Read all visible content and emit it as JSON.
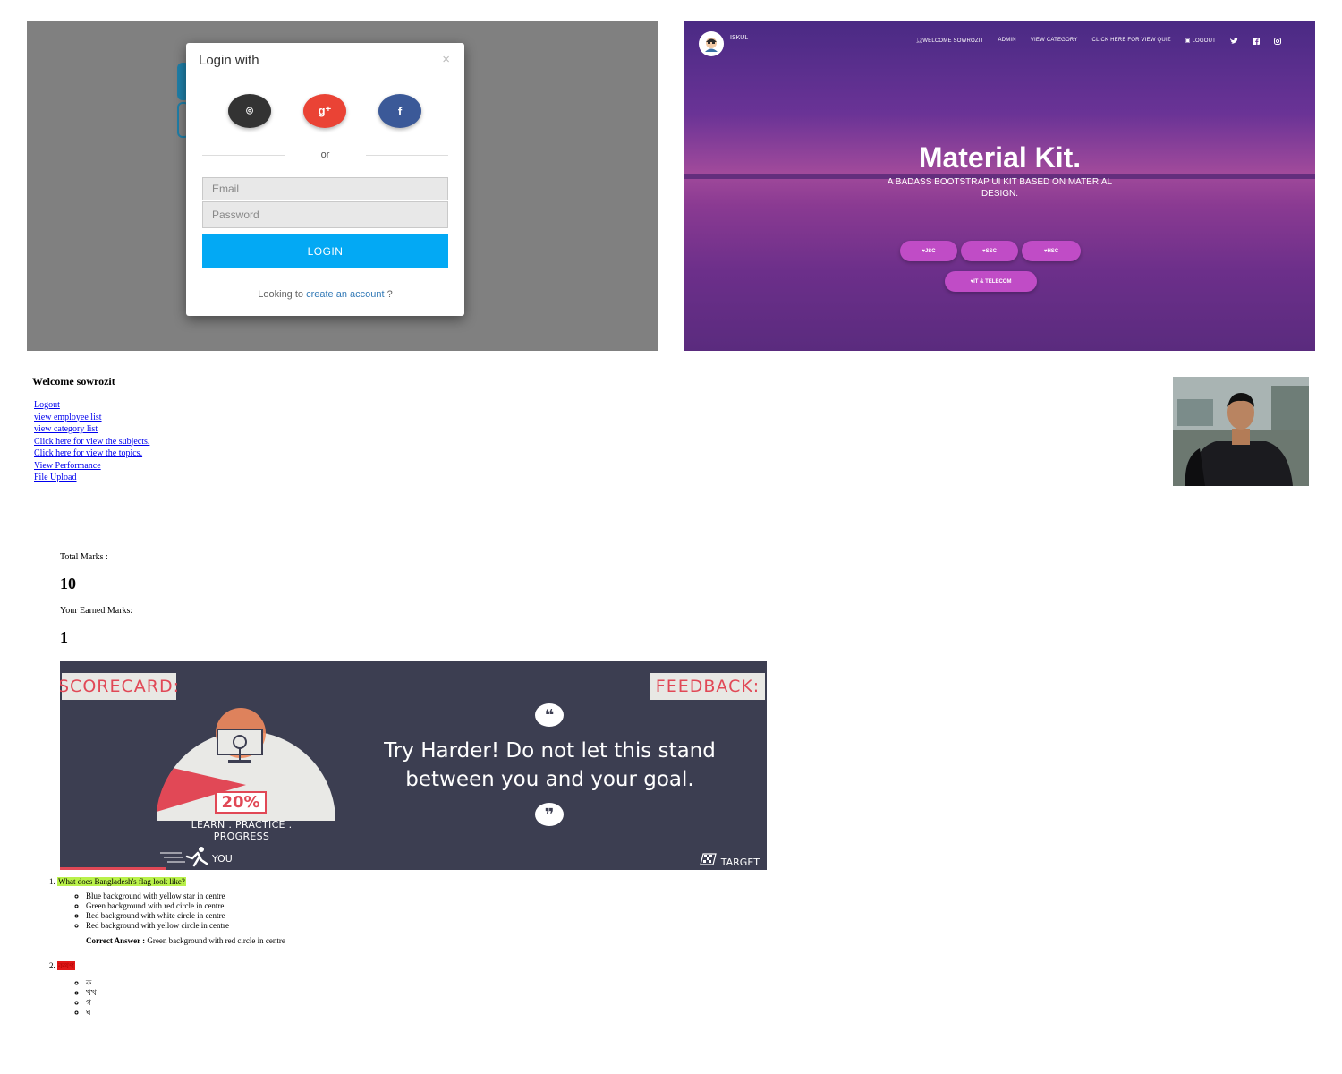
{
  "login": {
    "title": "Login with",
    "close": "×",
    "social": [
      {
        "name": "github",
        "glyph": "⌾",
        "color": "#333333"
      },
      {
        "name": "google-plus",
        "glyph": "g⁺",
        "color": "#ea4335"
      },
      {
        "name": "facebook",
        "glyph": "f",
        "color": "#3b5998"
      }
    ],
    "or": "or",
    "email_placeholder": "Email",
    "password_placeholder": "Password",
    "login_label": "LOGIN",
    "footer_prefix": "Looking to",
    "footer_link": "create an account",
    "footer_suffix": "?"
  },
  "hero": {
    "brand": "ISKUL",
    "nav": [
      "WELCOME SOWROZIT",
      "ADMIN",
      "VIEW CATEGORY",
      "CLICK HERE FOR VIEW QUIZ",
      "LOGOUT"
    ],
    "title": "Material Kit.",
    "subtitle": "A BADASS BOOTSTRAP UI KIT BASED ON MATERIAL DESIGN.",
    "pills": [
      "JSC",
      "SSC",
      "HSC",
      "IT & TELECOM"
    ],
    "accent": "#c04cc6"
  },
  "welcome": {
    "heading": "Welcome sowrozit",
    "links": [
      "Logout",
      "view employee list",
      "view category list",
      "Click here for view the subjects.",
      "Click here for view the topics.",
      "View Performance",
      "File Upload"
    ]
  },
  "marks": {
    "total_label": "Total Marks :",
    "total_value": "10",
    "earned_label": "Your Earned Marks:",
    "earned_value": "1"
  },
  "scorecard": {
    "scorecard_label": "SCORECARD:",
    "feedback_label": "FEEDBACK:",
    "score_fraction": 0.2,
    "percent": "20%",
    "tagline": "LEARN . PRACTICE . PROGRESS",
    "you_label": "YOU",
    "target_label": "TARGET",
    "quote": "Try Harder! Do not let this stand between you and your goal.",
    "open_quote": "❝",
    "close_quote": "❞",
    "background": "#3c3e51",
    "accent": "#e14856"
  },
  "questions": [
    {
      "text": "What does Bangladesh's flag look like?",
      "highlight": "#b9f14a",
      "options": [
        "Blue background with yellow star in centre",
        "Green background with red circle in centre",
        "Red background with white circle in centre",
        "Red background with yellow circle in centre"
      ],
      "correct_label": "Correct Answer :",
      "correct_value": "Green background with red circle in centre"
    },
    {
      "text": "কখগ",
      "highlight": "#e01818",
      "options": [
        "ক",
        "খখ",
        "গ",
        "ঘ"
      ]
    }
  ]
}
